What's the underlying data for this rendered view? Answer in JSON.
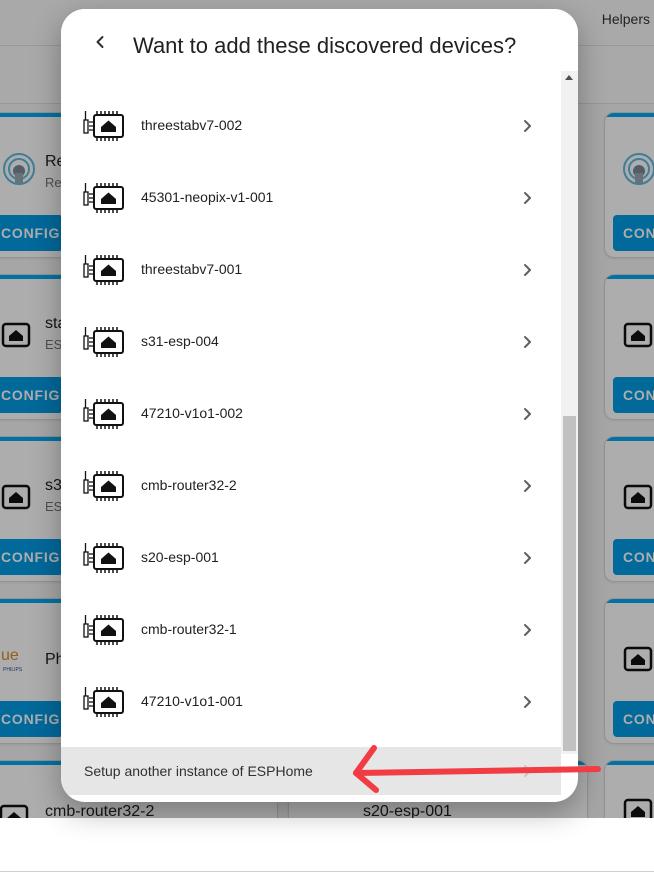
{
  "background": {
    "topbar": {
      "helpers_label": "Helpers"
    },
    "cards_left": [
      {
        "title": "Re",
        "subtitle": "Re",
        "button": "CONFIGURE",
        "icon": "radio-home-icon"
      },
      {
        "title": "sta",
        "subtitle": "ES",
        "button": "CONFIGURE",
        "icon": "esphome-icon"
      },
      {
        "title": "s3",
        "subtitle": "ES",
        "button": "CONFIGURE",
        "icon": "esphome-icon"
      },
      {
        "title": "Ph",
        "subtitle": "",
        "button": "CONFIGURE",
        "icon": "hue-logo",
        "logo_text": "ue",
        "logo_sub": "PHILIPS"
      },
      {
        "title": "cmb-router32-2",
        "subtitle": "",
        "button": "",
        "icon": "esphome-icon"
      }
    ],
    "cards_right": [
      {
        "button": "CON",
        "icon": "radio-home-icon"
      },
      {
        "button": "CON",
        "icon": "esphome-icon"
      },
      {
        "button": "CON",
        "icon": "esphome-icon"
      },
      {
        "button": "CON",
        "icon": "esphome-icon"
      },
      {
        "button": "",
        "icon": "esphome-icon"
      }
    ],
    "bottom_middle_title": "s20-esp-001"
  },
  "dialog": {
    "title": "Want to add these discovered devices?",
    "back_icon": "chevron-left-icon",
    "devices": [
      {
        "name": "threestabv7-002"
      },
      {
        "name": "45301-neopix-v1-001"
      },
      {
        "name": "threestabv7-001"
      },
      {
        "name": "s31-esp-004"
      },
      {
        "name": "47210-v1o1-002"
      },
      {
        "name": "cmb-router32-2"
      },
      {
        "name": "s20-esp-001"
      },
      {
        "name": "cmb-router32-1"
      },
      {
        "name": "47210-v1o1-001"
      }
    ],
    "device_icon": "esphome-icon",
    "chevron_icon": "chevron-right-icon",
    "setup_label": "Setup another instance of ESPHome"
  },
  "colors": {
    "accent": "#039be5",
    "annotation_arrow": "#f23c44",
    "highlight_row": "#e6e6e6"
  }
}
